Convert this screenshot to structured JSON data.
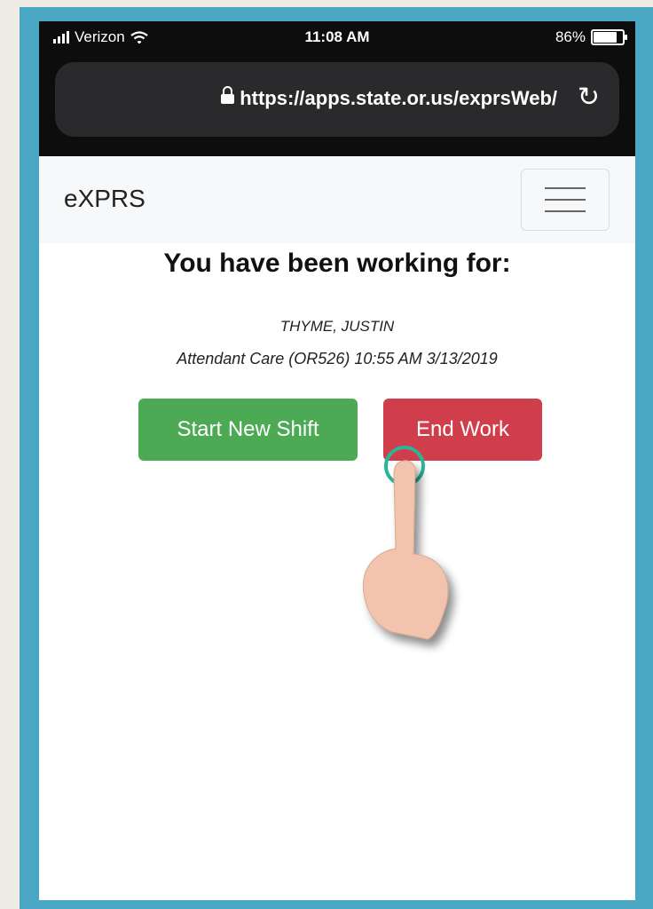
{
  "status": {
    "carrier": "Verizon",
    "time": "11:08 AM",
    "battery": "86%",
    "battery_level": 0.86
  },
  "browser": {
    "url": "https://apps.state.or.us/exprsWeb/"
  },
  "navbar": {
    "brand": "eXPRS"
  },
  "main": {
    "heading": "You have been working for:",
    "client_name": "THYME, JUSTIN",
    "service_detail": "Attendant Care (OR526) 10:55 AM 3/13/2019",
    "start_button": "Start New Shift",
    "end_button": "End Work"
  },
  "colors": {
    "frame": "#4aa7c4",
    "start": "#4caa55",
    "end": "#cf3e4a",
    "tap_ring": "#2bb598"
  }
}
